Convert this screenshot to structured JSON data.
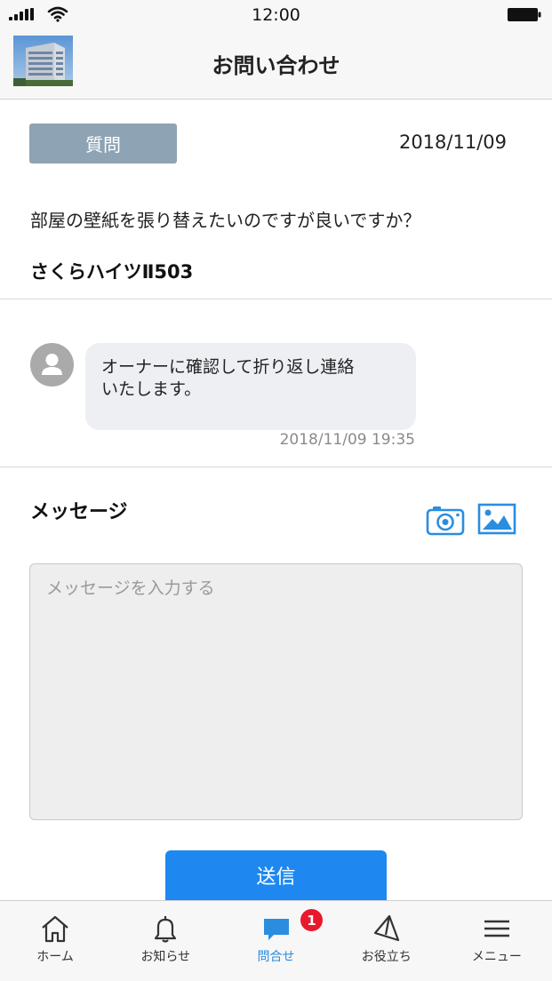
{
  "status_bar": {
    "time": "12:00"
  },
  "header": {
    "title": "お問い合わせ"
  },
  "inquiry": {
    "category": "質問",
    "date": "2018/11/09",
    "body": "部屋の壁紙を張り替えたいのですが良いですか？",
    "property": "さくらハイツⅡ503"
  },
  "chat": {
    "messages": [
      {
        "line1": "オーナーに確認して折り返し連絡",
        "line2": "いたします。",
        "time": "2018/11/09 19:35"
      }
    ]
  },
  "compose": {
    "title": "メッセージ",
    "placeholder": "メッセージを入力する",
    "send_label": "送信"
  },
  "tabs": [
    {
      "label": "ホーム",
      "icon": "home-icon"
    },
    {
      "label": "お知らせ",
      "icon": "bell-icon"
    },
    {
      "label": "問合せ",
      "icon": "chat-bubble-icon",
      "active": true
    },
    {
      "label": "お役立ち",
      "icon": "paper-plane-icon"
    },
    {
      "label": "メニュー",
      "icon": "hamburger-menu-icon"
    }
  ],
  "notification_badge": "1",
  "colors": {
    "accent": "#1e88f0",
    "badge": "#e8192c",
    "category": "#8ea3b3",
    "bubble": "#eeeff3"
  }
}
